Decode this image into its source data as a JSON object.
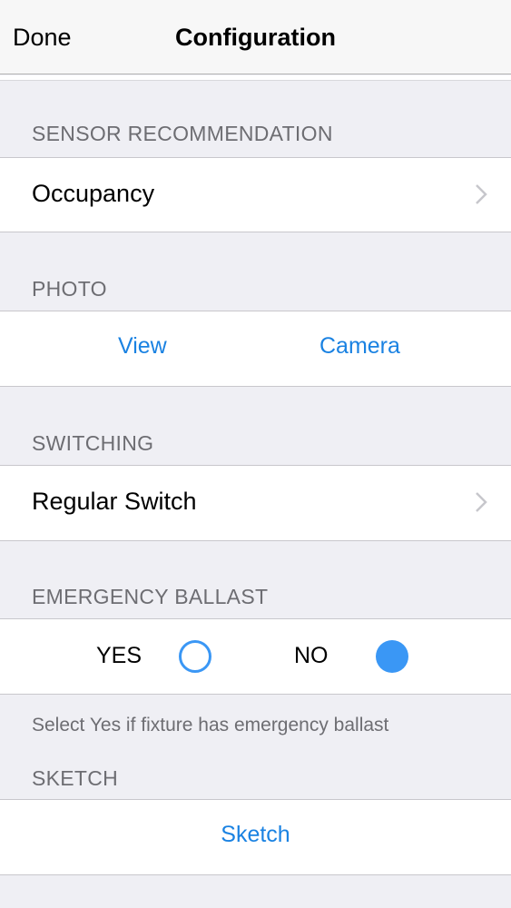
{
  "navbar": {
    "left_label": "Done",
    "title": "Configuration"
  },
  "sections": {
    "sensor": {
      "header": "SENSOR RECOMMENDATION",
      "value": "Occupancy"
    },
    "photo": {
      "header": "PHOTO",
      "view_label": "View",
      "camera_label": "Camera"
    },
    "switching": {
      "header": "SWITCHING",
      "value": "Regular Switch"
    },
    "emergency": {
      "header": "EMERGENCY BALLAST",
      "yes_label": "YES",
      "no_label": "NO",
      "selected": "NO",
      "footnote": "Select Yes if fixture has emergency ballast"
    },
    "sketch": {
      "header": "SKETCH",
      "button_label": "Sketch"
    }
  },
  "colors": {
    "accent": "#1a82e2",
    "radio": "#3a97f5",
    "header_text": "#6d6d72",
    "background": "#efeff4"
  },
  "icons": {
    "chevron": "chevron-right-icon"
  }
}
